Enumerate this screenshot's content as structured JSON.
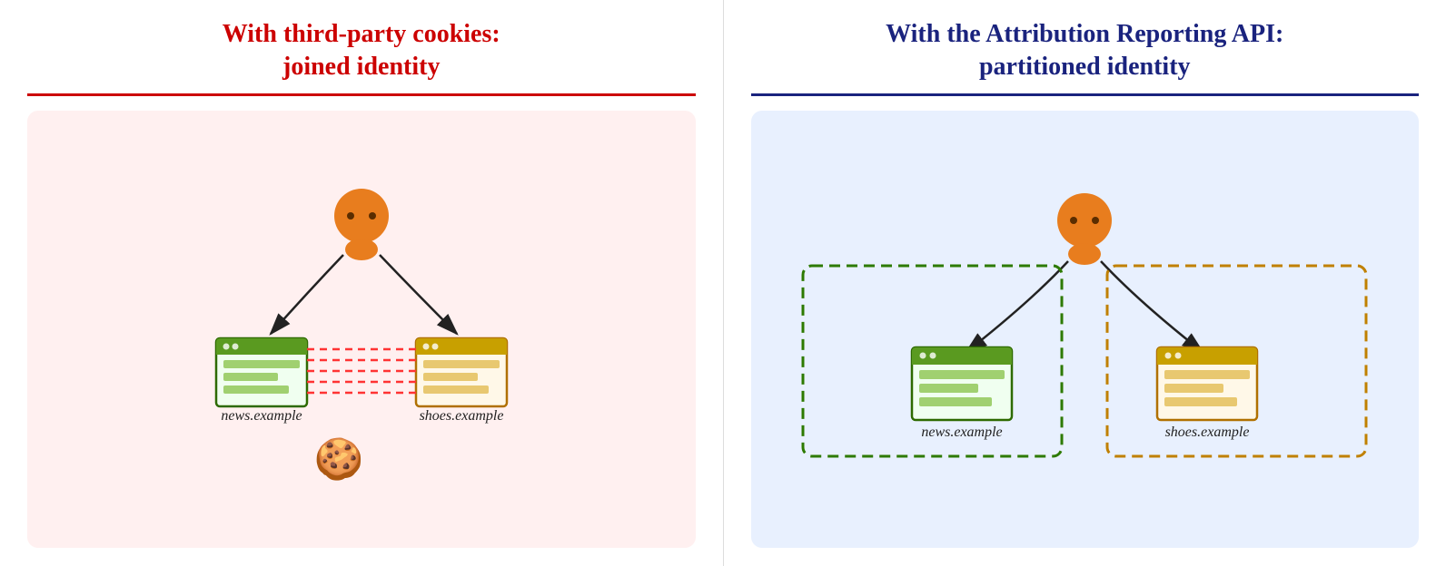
{
  "left_panel": {
    "title_line1": "With third-party cookies:",
    "title_line2": "joined identity",
    "label_news": "news.example",
    "label_shoes": "shoes.example"
  },
  "right_panel": {
    "title_line1": "With the Attribution Reporting API:",
    "title_line2": "partitioned identity",
    "label_news": "news.example",
    "label_shoes": "shoes.example"
  }
}
